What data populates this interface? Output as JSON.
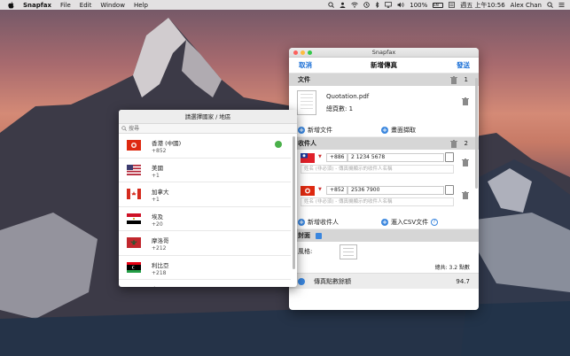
{
  "menubar": {
    "app_name": "Snapfax",
    "menus": [
      "File",
      "Edit",
      "Window",
      "Help"
    ],
    "battery": "100%",
    "battery_icon_text": "EN",
    "datetime": "週五 上午10:56",
    "user": "Alex Chan"
  },
  "window": {
    "title": "Snapfax",
    "nav": {
      "cancel": "取消",
      "title": "新增傳真",
      "send": "發送"
    },
    "documents": {
      "header": "文件",
      "count": "1",
      "file_name": "Quotation.pdf",
      "total_pages": "總頁數: 1",
      "add_document": "新增文件",
      "capture_screen": "畫面擷取"
    },
    "recipients": {
      "header": "收件人",
      "count": "2",
      "items": [
        {
          "country_code": "+886",
          "number": "2 1234 5678",
          "name_placeholder": "姓名 (非必須) - 傳真機顯示的收件人名稱",
          "flag": "taiwan-flag"
        },
        {
          "country_code": "+852",
          "number": "2536 7900",
          "name_placeholder": "姓名 (非必須) - 傳真機顯示的收件人名稱",
          "flag": "hong-kong-flag"
        }
      ],
      "add_recipient": "新增收件人",
      "import_csv": "滙入CSV文件",
      "help": "?"
    },
    "cover": {
      "header": "封面",
      "style_label": "風格:",
      "total_points": "總共: 3.2 點數"
    },
    "fax_points": {
      "label": "傳真點數餘額",
      "value": "94.7"
    }
  },
  "country_picker": {
    "title": "請選擇國家 / 地區",
    "search_placeholder": "搜尋",
    "countries": [
      {
        "name": "香港 (中國)",
        "code": "+852",
        "selected": true
      },
      {
        "name": "美國",
        "code": "+1",
        "selected": false
      },
      {
        "name": "加拿大",
        "code": "+1",
        "selected": false
      },
      {
        "name": "埃及",
        "code": "+20",
        "selected": false
      },
      {
        "name": "摩洛哥",
        "code": "+212",
        "selected": false
      },
      {
        "name": "利比亞",
        "code": "+218",
        "selected": false
      },
      {
        "name": "突尼",
        "code": "",
        "selected": false
      }
    ]
  },
  "colors": {
    "accent": "#1a6fd6",
    "section_bg": "#d6d6d6",
    "check": "#4ab04a"
  }
}
